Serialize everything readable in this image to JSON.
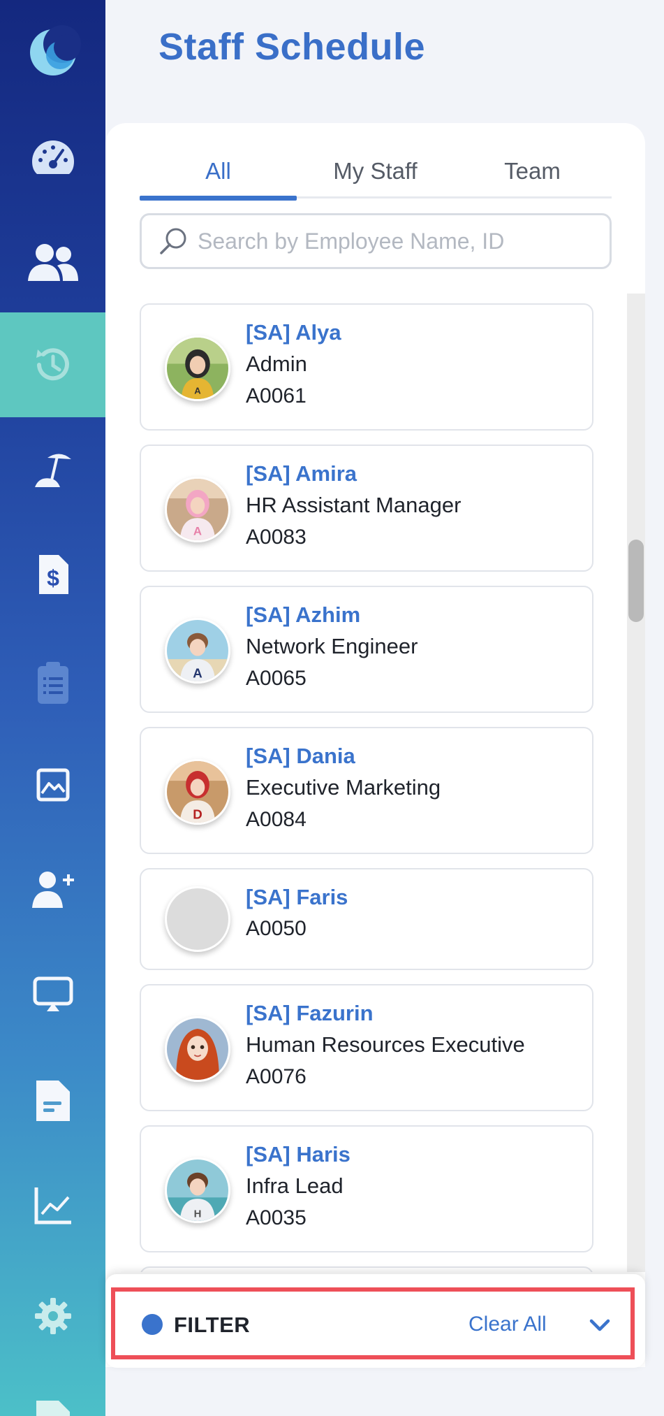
{
  "header": {
    "title": "Staff Schedule"
  },
  "tabs": [
    {
      "label": "All",
      "active": true
    },
    {
      "label": "My Staff",
      "active": false
    },
    {
      "label": "Team",
      "active": false
    }
  ],
  "search": {
    "placeholder": "Search by Employee Name, ID",
    "value": ""
  },
  "sidebar": {
    "items": [
      {
        "icon": "moon-logo-icon"
      },
      {
        "icon": "dashboard-gauge-icon"
      },
      {
        "icon": "users-icon"
      },
      {
        "icon": "attendance-history-icon",
        "active": true
      },
      {
        "icon": "leave-beach-icon"
      },
      {
        "icon": "payroll-dollar-icon"
      },
      {
        "icon": "clipboard-icon"
      },
      {
        "icon": "gallery-image-icon"
      },
      {
        "icon": "add-user-icon"
      },
      {
        "icon": "presentation-icon"
      },
      {
        "icon": "document-icon"
      },
      {
        "icon": "analytics-chart-icon"
      },
      {
        "icon": "settings-gear-icon"
      },
      {
        "icon": "file-icon"
      }
    ]
  },
  "employees": [
    {
      "name": "[SA] Alya",
      "role": "Admin",
      "id": "A0061"
    },
    {
      "name": "[SA] Amira",
      "role": "HR Assistant Manager",
      "id": "A0083"
    },
    {
      "name": "[SA] Azhim",
      "role": "Network Engineer",
      "id": "A0065"
    },
    {
      "name": "[SA] Dania",
      "role": "Executive Marketing",
      "id": "A0084"
    },
    {
      "name": "[SA] Faris",
      "role": "",
      "id": "A0050"
    },
    {
      "name": "[SA] Fazurin",
      "role": "Human Resources Executive",
      "id": "A0076"
    },
    {
      "name": "[SA] Haris",
      "role": "Infra Lead",
      "id": "A0035"
    }
  ],
  "filter": {
    "label": "FILTER",
    "clear_label": "Clear All"
  },
  "colors": {
    "accent": "#3a73cc",
    "active_sidebar": "#5ec7c0",
    "highlight": "#ee4f58"
  }
}
